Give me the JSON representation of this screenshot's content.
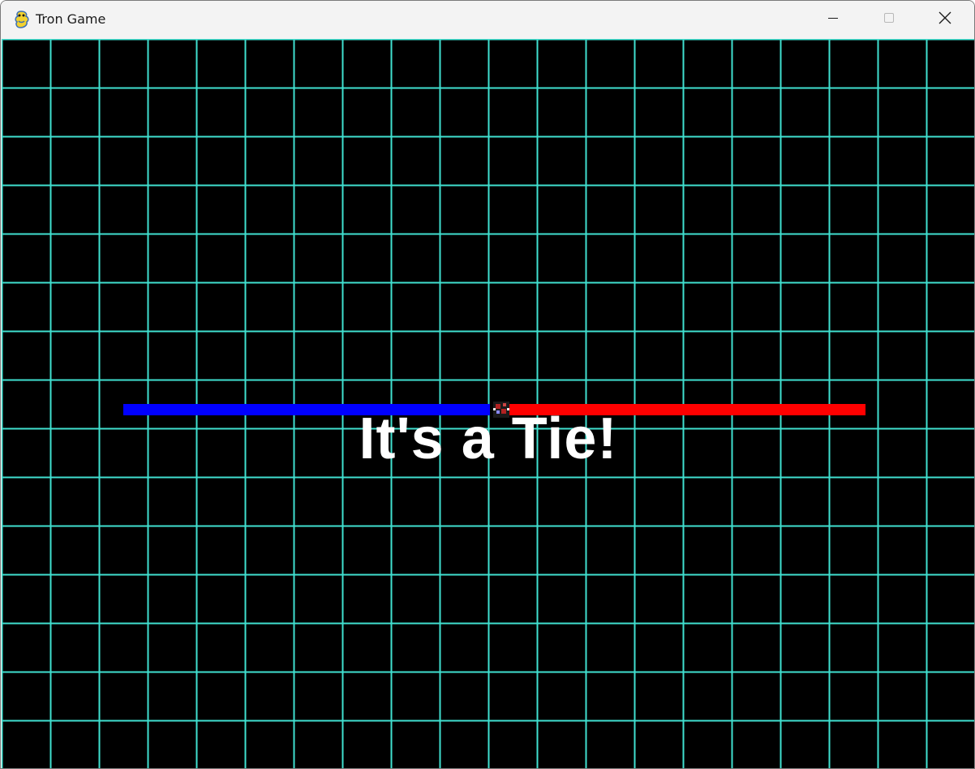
{
  "window": {
    "title": "Tron Game",
    "icon": "pygame-snake-icon"
  },
  "controls": {
    "minimize_icon": "minimize-icon",
    "maximize_icon": "maximize-icon",
    "close_icon": "close-icon"
  },
  "game": {
    "background_color": "#000000",
    "grid_color": "#40e0d0",
    "message": "It's a Tie!",
    "message_color": "#ffffff",
    "players": [
      {
        "name": "blue",
        "color": "#0000ff"
      },
      {
        "name": "red",
        "color": "#ff0000"
      }
    ]
  }
}
